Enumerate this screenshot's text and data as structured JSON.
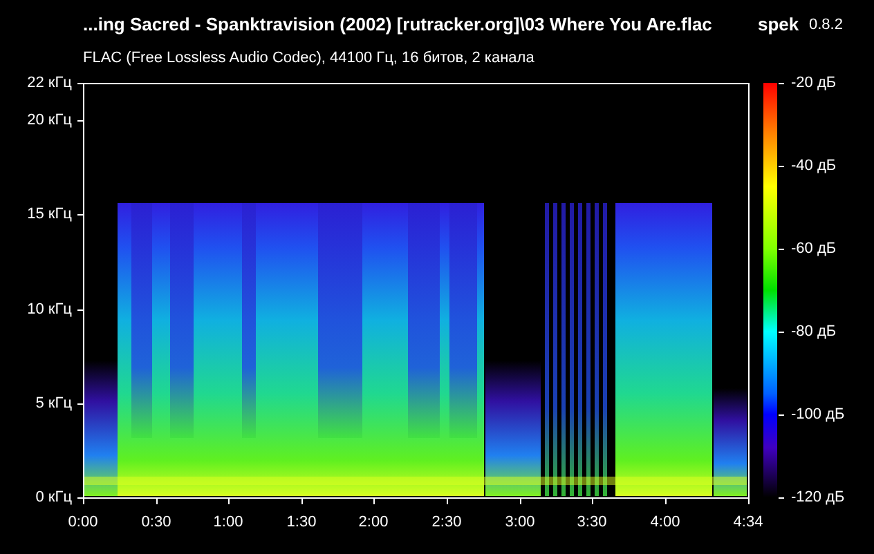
{
  "header": {
    "title": "...ing Sacred - Spanktravision (2002) [rutracker.org]\\03 Where You Are.flac",
    "app_name": "spek",
    "version": "0.8.2",
    "subtitle": "FLAC (Free Lossless Audio Codec), 44100 Гц, 16 битов, 2 канала"
  },
  "spectrogram": {
    "frequency_ticks": [
      "22 кГц",
      "20 кГц",
      "15 кГц",
      "10 кГц",
      "5 кГц",
      "0 кГц"
    ],
    "time_ticks": [
      "0:00",
      "0:30",
      "1:00",
      "1:30",
      "2:00",
      "2:30",
      "3:00",
      "3:30",
      "4:00",
      "4:34"
    ],
    "level_ticks": [
      "-20 дБ",
      "-40 дБ",
      "-60 дБ",
      "-80 дБ",
      "-100 дБ",
      "-120 дБ"
    ]
  }
}
